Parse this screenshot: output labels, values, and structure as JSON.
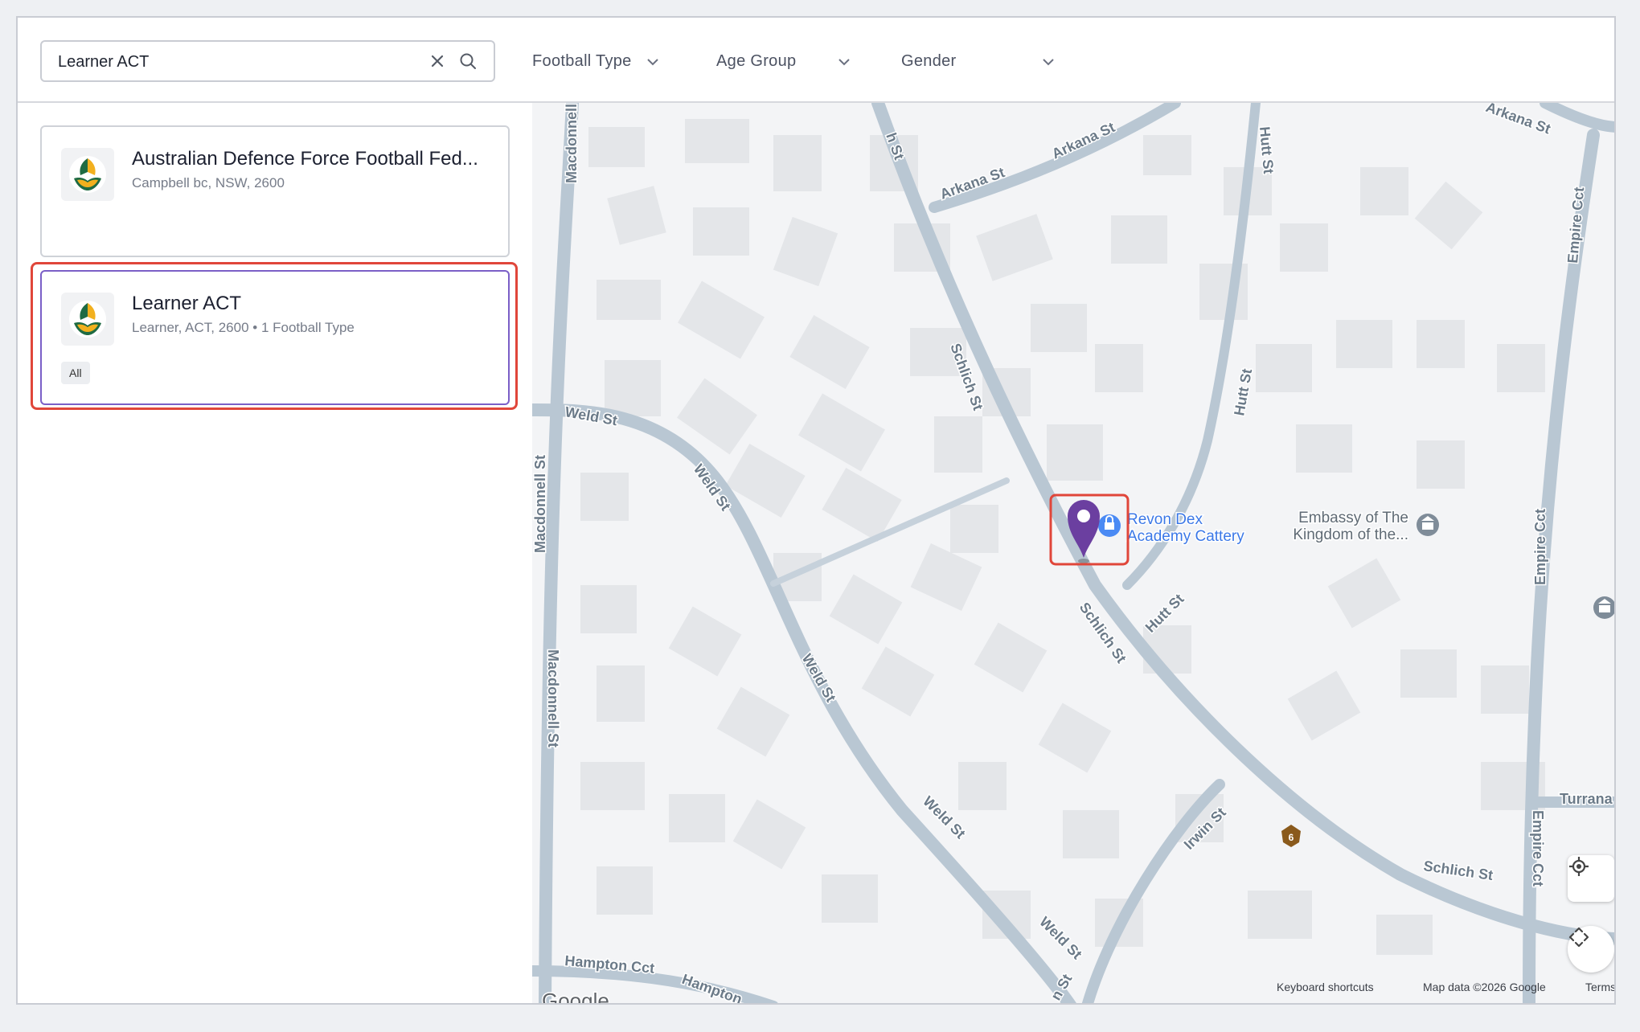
{
  "search": {
    "value": "Learner ACT",
    "clear_icon": "close-icon",
    "search_icon": "search-icon"
  },
  "filters": [
    {
      "label": "Football Type",
      "icon": "chevron-down-icon"
    },
    {
      "label": "Age Group",
      "icon": "chevron-down-icon"
    },
    {
      "label": "Gender",
      "icon": "chevron-down-icon"
    }
  ],
  "results": [
    {
      "title": "Australian Defence Force Football Fed...",
      "subtitle": "Campbell bc, NSW, 2600",
      "logo": "football-australia-logo"
    },
    {
      "title": "Learner ACT",
      "subtitle": "Learner, ACT, 2600 • 1 Football Type",
      "tag": "All",
      "logo": "football-australia-logo",
      "selected": true
    }
  ],
  "map": {
    "streets": [
      "Arkana St",
      "Arkana St",
      "Arkana St",
      "Macdonnell St",
      "Macdonnell St",
      "Macdonnell St",
      "Weld St",
      "Weld St",
      "Weld St",
      "Weld St",
      "Weld St",
      "Schlich St",
      "Schlich St",
      "Schlich St",
      "Hutt St",
      "Hutt St",
      "Hutt St",
      "Empire Cct",
      "Empire Cct",
      "Empire Cct",
      "Irwin St",
      "Hampton Cct",
      "Hampton",
      "h St",
      "n St",
      "Turrana"
    ],
    "pois": [
      "Revon Dex Academy Cattery",
      "Embassy of The Kingdom of the..."
    ],
    "route_shield": "6",
    "google_logo": "Google",
    "attribution": [
      "Keyboard shortcuts",
      "Map data ©2026 Google",
      "Terms"
    ],
    "controls": [
      "my-location-icon",
      "fullscreen-icon"
    ],
    "colors": {
      "road": "#b9c7d3",
      "building": "#e3e5e8",
      "land": "#f3f4f6",
      "pin": "#6b3fa0",
      "poi_text": "#3b78e7"
    }
  }
}
